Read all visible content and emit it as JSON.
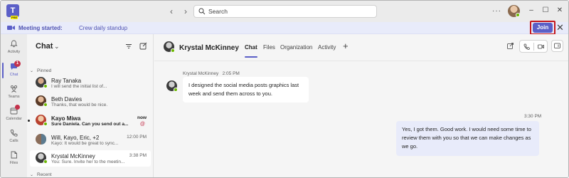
{
  "titlebar": {
    "logo_text": "T",
    "logo_badge": "PRE",
    "search_placeholder": "Search",
    "more_label": "···"
  },
  "banner": {
    "title": "Meeting started:",
    "subtitle": "Crew daily standup",
    "join_label": "Join"
  },
  "appbar": {
    "items": [
      {
        "label": "Activity",
        "icon": "bell-icon"
      },
      {
        "label": "Chat",
        "icon": "chat-icon",
        "badge": "1"
      },
      {
        "label": "Teams",
        "icon": "teams-icon"
      },
      {
        "label": "Calendar",
        "icon": "calendar-icon"
      },
      {
        "label": "Calls",
        "icon": "phone-icon"
      },
      {
        "label": "Files",
        "icon": "file-icon"
      }
    ]
  },
  "chatlist": {
    "title": "Chat",
    "pinned_label": "Pinned",
    "recent_label": "Recent",
    "rows": [
      {
        "name": "Ray Tanaka",
        "preview": "I will send the initial list of...",
        "time": ""
      },
      {
        "name": "Beth Davies",
        "preview": "Thanks, that would be nice.",
        "time": ""
      },
      {
        "name": "Kayo Miwa",
        "preview": "Sure Daniela. Can you send out a...",
        "time": "now"
      },
      {
        "name": "Will, Kayo, Eric, +2",
        "preview": "Kayo: It would be great to sync...",
        "time": "12:00 PM"
      },
      {
        "name": "Krystal McKinney",
        "preview": "You: Sure. Invite her to the meetin...",
        "time": "3:38 PM"
      }
    ]
  },
  "header": {
    "name": "Krystal McKinney",
    "tabs": [
      "Chat",
      "Files",
      "Organization",
      "Activity"
    ]
  },
  "conversation": {
    "incoming": {
      "sender": "Krystal McKinney",
      "time": "2:05 PM",
      "text": "I designed the social media posts graphics last week and send them across to you."
    },
    "outgoing": {
      "time": "3:30 PM",
      "text": "Yes, I got them. Good work. I would need some time to review them with you so that we can make changes as we go."
    }
  },
  "colors": {
    "brand": "#5b5fc7",
    "presence": "#6bb700",
    "alert": "#c4314b"
  }
}
